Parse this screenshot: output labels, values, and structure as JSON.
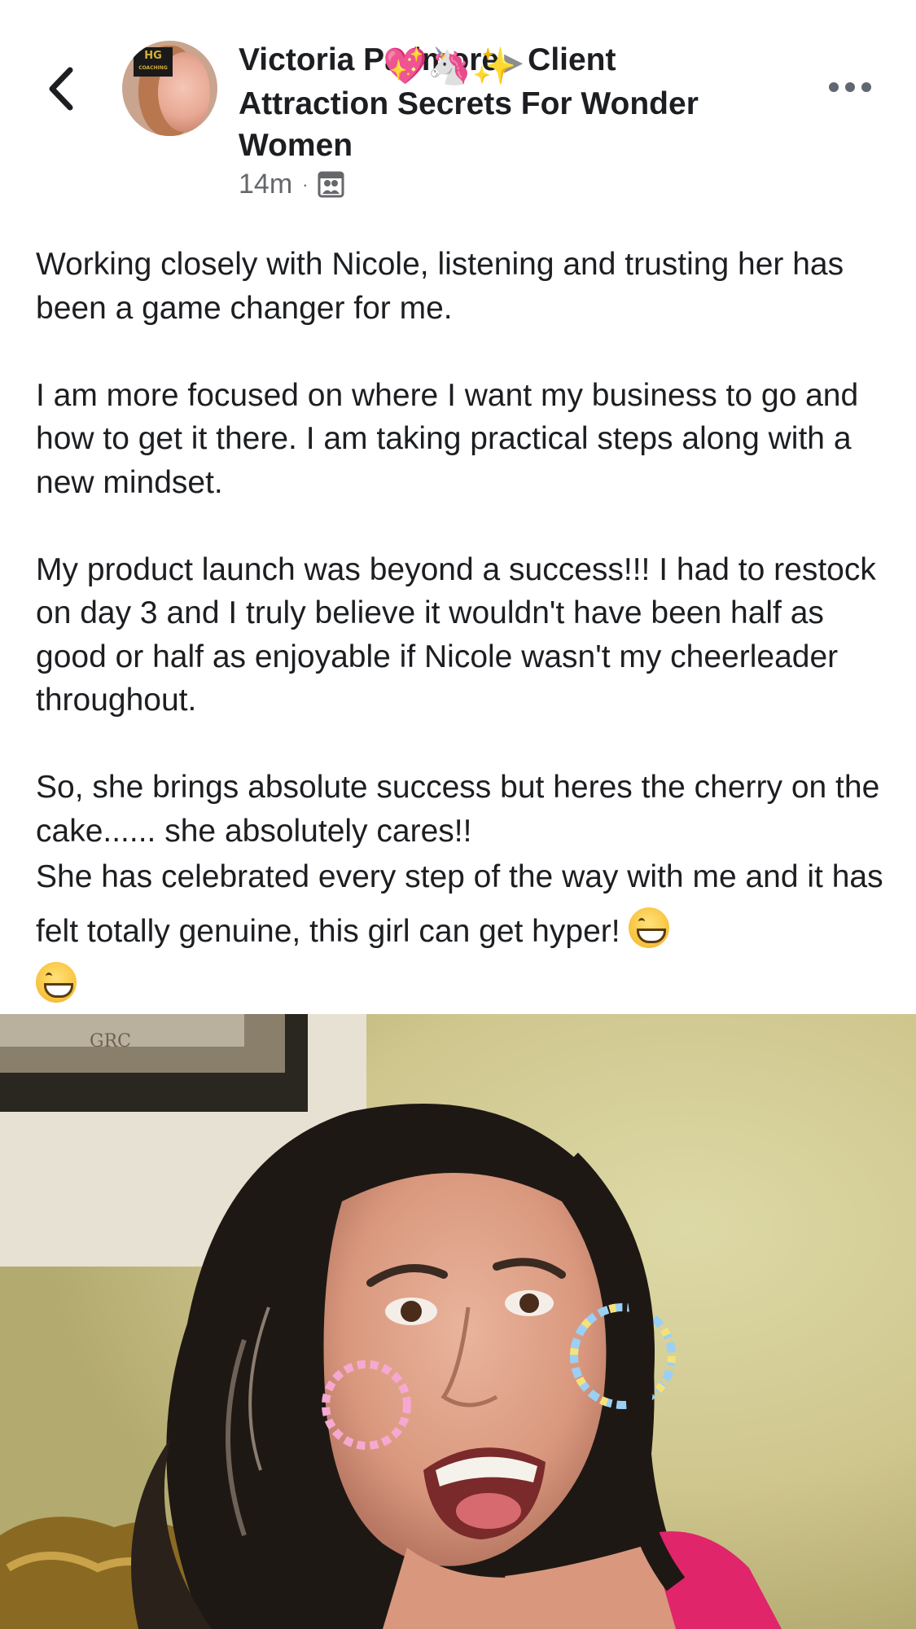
{
  "header": {
    "title_part1": "Victoria Padmore",
    "title_part2": "Client Attraction Secrets For Wonder Women",
    "title_emojis": "💖🦄✨",
    "time": "14m",
    "separator": "·"
  },
  "icons": {
    "back": "chevron-left-icon",
    "more": "more-horizontal-icon",
    "audience": "group-icon"
  },
  "post": {
    "paragraphs": [
      "Working closely with Nicole, listening and trusting her has been a game changer for me.",
      "I am more focused on where I want my business to go and how to get it there. I am taking practical steps along with a new mindset.",
      "My product launch was beyond a success!!! I had to restock on day 3 and I truly believe it wouldn't have been half as good or half as enjoyable if Nicole wasn't my cheerleader throughout.",
      "So, she brings absolute success but heres the cherry on the cake...... she absolutely cares!!",
      "She has celebrated every step of the way with me and it has felt totally genuine, this girl can get hyper!"
    ],
    "trailing_emoji": "😁",
    "trailing_emoji_2": "😁"
  },
  "photo": {
    "subject": "selfie of smiling woman with dark wavy hair and colorful beaded hoop earrings",
    "frame_signature": "GRC"
  },
  "colors": {
    "text": "#1c1e21",
    "meta": "#65676b",
    "icon": "#606770",
    "background": "#ffffff"
  }
}
